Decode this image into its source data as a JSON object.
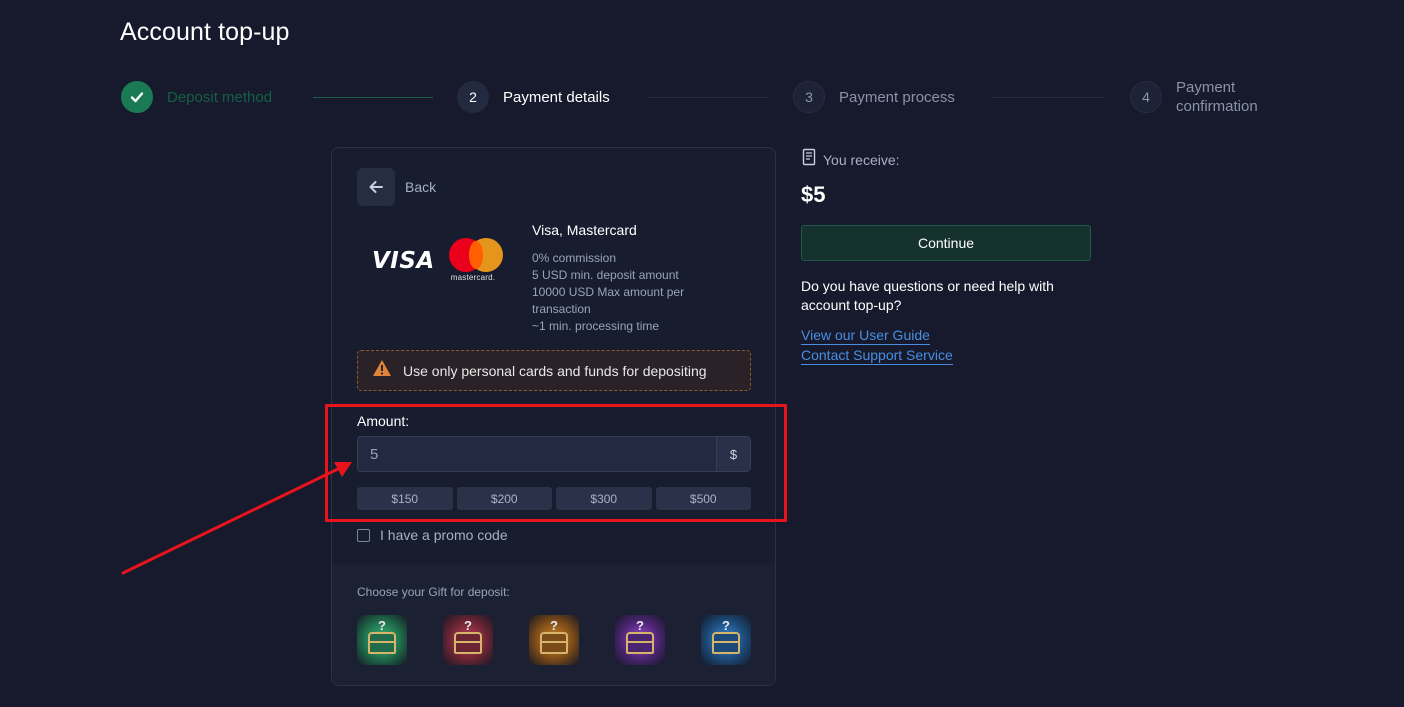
{
  "page_title": "Account top-up",
  "stepper": {
    "steps": [
      {
        "number": "",
        "label": "Deposit method",
        "state": "done"
      },
      {
        "number": "2",
        "label": "Payment details",
        "state": "active"
      },
      {
        "number": "3",
        "label": "Payment process",
        "state": "pending"
      },
      {
        "number": "4",
        "label": "Payment\nconfirmation",
        "state": "pending"
      }
    ]
  },
  "card": {
    "back_label": "Back",
    "brand_visa": "VISA",
    "brand_mastercard": "mastercard.",
    "method_name": "Visa, Mastercard",
    "details": [
      "0% commission",
      "5 USD min. deposit amount",
      "10000 USD Max amount per transaction",
      "~1 min. processing time"
    ],
    "warning": "Use only personal cards and funds for depositing",
    "amount_label": "Amount:",
    "amount_value": "5",
    "currency": "$",
    "presets": [
      "$150",
      "$200",
      "$300",
      "$500"
    ],
    "promo_label": "I have a promo code",
    "gift_title": "Choose your Gift for deposit:",
    "gifts": [
      {
        "color": "#1f6b4a",
        "glow": "#3bbf7a"
      },
      {
        "color": "#6b2434",
        "glow": "#c0405a"
      },
      {
        "color": "#7a4a18",
        "glow": "#d58a2a"
      },
      {
        "color": "#4a2470",
        "glow": "#9a4ad8"
      },
      {
        "color": "#1c4a78",
        "glow": "#3a8ad8"
      }
    ],
    "gift_mark": "?"
  },
  "summary": {
    "receive_label": "You receive:",
    "receive_amount": "$5",
    "continue_label": "Continue",
    "help_text": "Do you have questions or need help with account top-up?",
    "link_guide": "View our User Guide",
    "link_support": "Contact Support Service"
  },
  "colors": {
    "background": "#161a2c",
    "accent_green": "#1a7a55",
    "link_blue": "#4a8ee0",
    "annotation_red": "#e8141b"
  }
}
